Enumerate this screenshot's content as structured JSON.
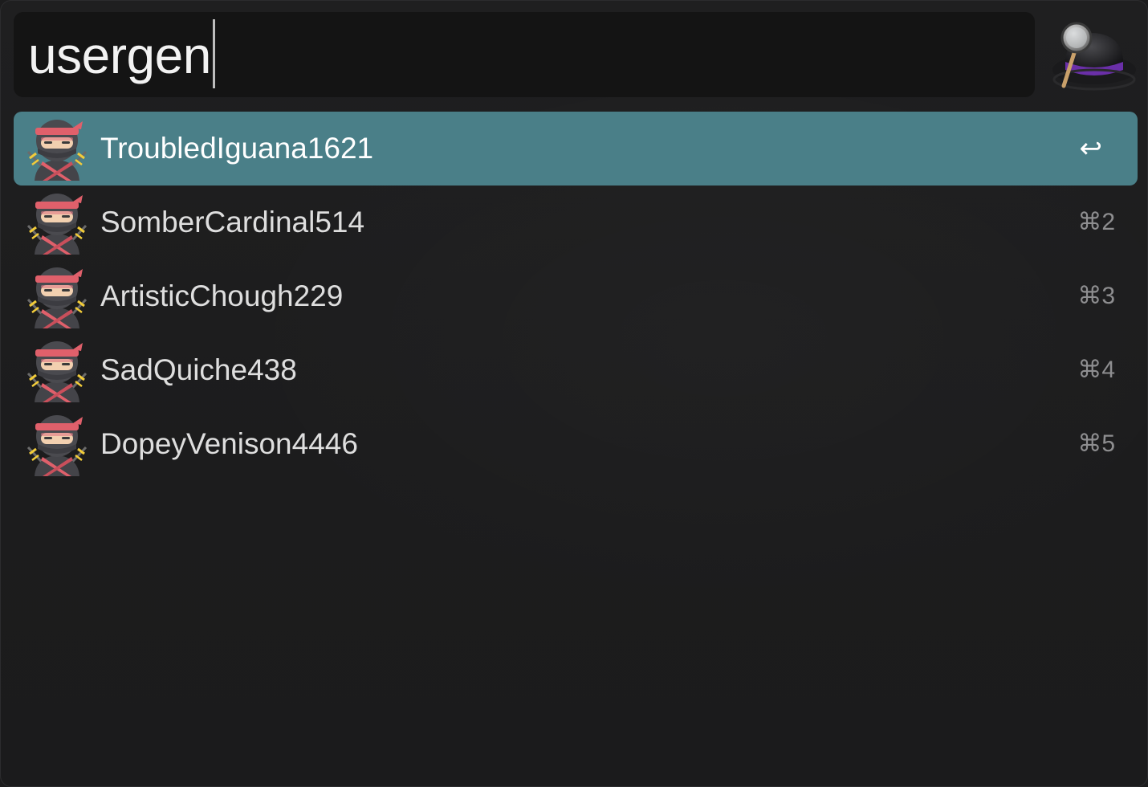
{
  "search": {
    "query": "usergen"
  },
  "results": [
    {
      "title": "TroubledIguana1621",
      "shortcut": "↩",
      "selected": true
    },
    {
      "title": "SomberCardinal514",
      "shortcut": "⌘2",
      "selected": false
    },
    {
      "title": "ArtisticChough229",
      "shortcut": "⌘3",
      "selected": false
    },
    {
      "title": "SadQuiche438",
      "shortcut": "⌘4",
      "selected": false
    },
    {
      "title": "DopeyVenison4446",
      "shortcut": "⌘5",
      "selected": false
    }
  ],
  "icons": {
    "app_logo": "alfred-hat-magnifier-icon",
    "result_icon": "ninja-avatar-icon"
  },
  "colors": {
    "selection": "#4a7f88",
    "background": "#1c1c1d",
    "search_field": "#141414",
    "hat_band": "#6a2fa8",
    "ninja_headband": "#e0606b"
  }
}
